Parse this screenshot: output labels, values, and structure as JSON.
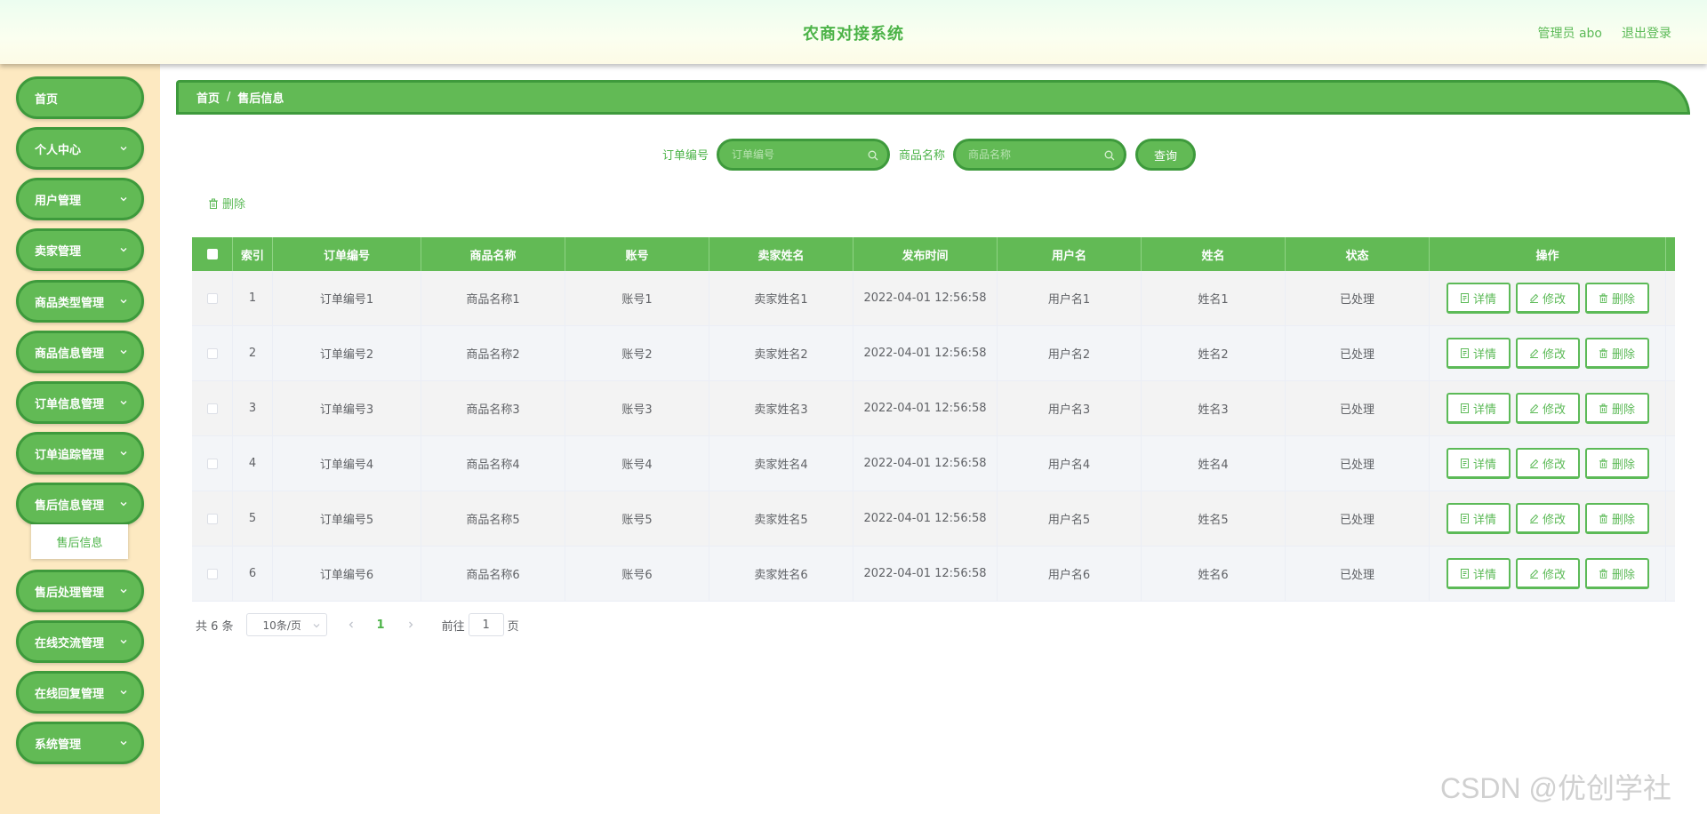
{
  "header": {
    "title": "农商对接系统",
    "user_label": "管理员 abo",
    "logout_label": "退出登录"
  },
  "sidebar": {
    "items": [
      {
        "label": "首页",
        "has_arrow": false
      },
      {
        "label": "个人中心",
        "has_arrow": true
      },
      {
        "label": "用户管理",
        "has_arrow": true
      },
      {
        "label": "卖家管理",
        "has_arrow": true
      },
      {
        "label": "商品类型管理",
        "has_arrow": true
      },
      {
        "label": "商品信息管理",
        "has_arrow": true
      },
      {
        "label": "订单信息管理",
        "has_arrow": true
      },
      {
        "label": "订单追踪管理",
        "has_arrow": true
      },
      {
        "label": "售后信息管理",
        "has_arrow": true
      },
      {
        "label": "售后处理管理",
        "has_arrow": true
      },
      {
        "label": "在线交流管理",
        "has_arrow": true
      },
      {
        "label": "在线回复管理",
        "has_arrow": true
      },
      {
        "label": "系统管理",
        "has_arrow": true
      }
    ],
    "submenu": {
      "label": "售后信息"
    }
  },
  "breadcrumb": {
    "home": "首页",
    "separator": "/",
    "current": "售后信息"
  },
  "search": {
    "order_label": "订单编号",
    "order_placeholder": "订单编号",
    "product_label": "商品名称",
    "product_placeholder": "商品名称",
    "query_button": "查询"
  },
  "toolbar": {
    "delete_label": "删除"
  },
  "table": {
    "columns": [
      "索引",
      "订单编号",
      "商品名称",
      "账号",
      "卖家姓名",
      "发布时间",
      "用户名",
      "姓名",
      "状态",
      "操作"
    ],
    "rows": [
      {
        "index": "1",
        "order_no": "订单编号1",
        "product": "商品名称1",
        "account": "账号1",
        "seller": "卖家姓名1",
        "time": "2022-04-01 12:56:58",
        "username": "用户名1",
        "name": "姓名1",
        "status": "已处理"
      },
      {
        "index": "2",
        "order_no": "订单编号2",
        "product": "商品名称2",
        "account": "账号2",
        "seller": "卖家姓名2",
        "time": "2022-04-01 12:56:58",
        "username": "用户名2",
        "name": "姓名2",
        "status": "已处理"
      },
      {
        "index": "3",
        "order_no": "订单编号3",
        "product": "商品名称3",
        "account": "账号3",
        "seller": "卖家姓名3",
        "time": "2022-04-01 12:56:58",
        "username": "用户名3",
        "name": "姓名3",
        "status": "已处理"
      },
      {
        "index": "4",
        "order_no": "订单编号4",
        "product": "商品名称4",
        "account": "账号4",
        "seller": "卖家姓名4",
        "time": "2022-04-01 12:56:58",
        "username": "用户名4",
        "name": "姓名4",
        "status": "已处理"
      },
      {
        "index": "5",
        "order_no": "订单编号5",
        "product": "商品名称5",
        "account": "账号5",
        "seller": "卖家姓名5",
        "time": "2022-04-01 12:56:58",
        "username": "用户名5",
        "name": "姓名5",
        "status": "已处理"
      },
      {
        "index": "6",
        "order_no": "订单编号6",
        "product": "商品名称6",
        "account": "账号6",
        "seller": "卖家姓名6",
        "time": "2022-04-01 12:56:58",
        "username": "用户名6",
        "name": "姓名6",
        "status": "已处理"
      }
    ],
    "actions": {
      "detail": "详情",
      "edit": "修改",
      "delete": "删除"
    }
  },
  "pagination": {
    "total_text": "共 6 条",
    "page_size": "10条/页",
    "current_page": "1",
    "goto_label": "前往",
    "goto_value": "1",
    "page_suffix": "页"
  },
  "watermark": "CSDN @优创学社",
  "colors": {
    "primary": "#62ba55",
    "primary_border": "#3e9a3c",
    "accent_text": "#4cb348",
    "sidebar_bg": "#fde9c1"
  }
}
